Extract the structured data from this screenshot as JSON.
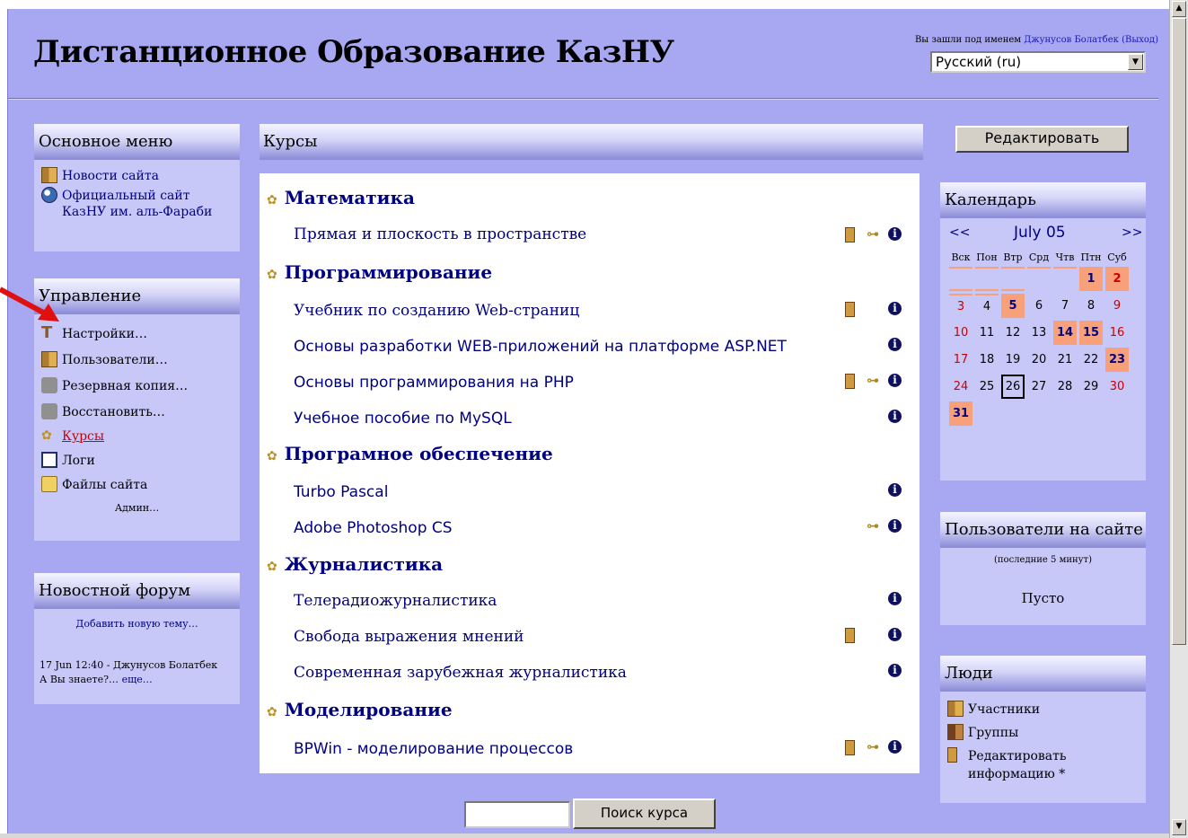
{
  "header": {
    "site_title": "Дистанционное Образование КазНУ",
    "login_prefix": "Вы зашли под именем ",
    "user_name": "Джунусов Болатбек",
    "logout_label": "(Выход)",
    "language": "Русский (ru)"
  },
  "main_menu": {
    "title": "Основное меню",
    "items": [
      {
        "label": "Новости сайта",
        "icon": "people-icon"
      },
      {
        "label": "Официальный сайт",
        "icon": "globe-icon"
      }
    ],
    "item2_line2": "КазНУ им. аль-Фараби"
  },
  "admin": {
    "title": "Управление",
    "items": [
      {
        "label": "Настройки…",
        "icon": "hammer-icon"
      },
      {
        "label": "Пользователи…",
        "icon": "people-icon"
      },
      {
        "label": "Резервная копия…",
        "icon": "backup-icon"
      },
      {
        "label": "Восстановить…",
        "icon": "restore-icon"
      },
      {
        "label": "Курсы",
        "icon": "course-icon"
      },
      {
        "label": "Логи",
        "icon": "log-icon"
      },
      {
        "label": "Файлы сайта",
        "icon": "folder-icon"
      }
    ],
    "admin_link": "Админ…"
  },
  "news_forum": {
    "title": "Новостной форум",
    "add_topic": "Добавить новую тему…",
    "post_date": "17 Jun 12:40 - Джунусов Болатбек",
    "post_title": "А Вы знаете?… ",
    "more_link": "еще…"
  },
  "courses": {
    "title": "Курсы",
    "categories": [
      {
        "name": "Математика",
        "courses": [
          {
            "name": "Прямая и плоскость в пространстве",
            "icons": [
              "doc-icon",
              "key-icon",
              "info-icon"
            ]
          }
        ]
      },
      {
        "name": "Программирование",
        "courses": [
          {
            "name": "Учебник по созданию Web-страниц",
            "icons": [
              "doc-icon",
              "info-icon"
            ]
          },
          {
            "name": "Основы разработки WEB-приложений на платформе ASP.NET",
            "icons": [
              "info-icon"
            ]
          },
          {
            "name": "Основы программирования на PHP",
            "icons": [
              "doc-icon",
              "key-icon",
              "info-icon"
            ]
          },
          {
            "name": "Учебное пособие по MySQL",
            "icons": [
              "info-icon"
            ]
          }
        ]
      },
      {
        "name": "Програмное обеспечение",
        "courses": [
          {
            "name": "Turbo Pascal",
            "icons": [
              "info-icon"
            ]
          },
          {
            "name": "Adobe Photoshop CS",
            "icons": [
              "key-icon",
              "info-icon"
            ]
          }
        ]
      },
      {
        "name": "Журналистика",
        "courses": [
          {
            "name": "Телерадиожурналистика",
            "icons": [
              "info-icon"
            ]
          },
          {
            "name": "Свобода выражения мнений",
            "icons": [
              "doc-icon",
              "info-icon"
            ]
          },
          {
            "name": "Современная зарубежная журналистика",
            "icons": [
              "info-icon"
            ]
          }
        ]
      },
      {
        "name": "Моделирование",
        "courses": [
          {
            "name": "BPWin - моделирование процессов",
            "icons": [
              "doc-icon",
              "key-icon",
              "info-icon"
            ]
          }
        ]
      }
    ]
  },
  "search": {
    "button_label": "Поиск курса",
    "value": ""
  },
  "edit_button": "Редактировать",
  "calendar": {
    "title": "Календарь",
    "prev": "<<",
    "month": "July 05",
    "next": ">>",
    "weekdays": [
      "Вск",
      "Пон",
      "Втр",
      "Срд",
      "Чтв",
      "Птн",
      "Суб"
    ],
    "days": [
      "1",
      "2",
      "3",
      "4",
      "5",
      "6",
      "7",
      "8",
      "9",
      "10",
      "11",
      "12",
      "13",
      "14",
      "15",
      "16",
      "17",
      "18",
      "19",
      "20",
      "21",
      "22",
      "23",
      "24",
      "25",
      "26",
      "27",
      "28",
      "29",
      "30",
      "31"
    ],
    "event_days": [
      "1",
      "2",
      "3",
      "5",
      "14",
      "15",
      "23",
      "31"
    ],
    "today": "26"
  },
  "online_users": {
    "title": "Пользователи на сайте",
    "subtitle": "(последние 5 минут)",
    "empty": "Пусто"
  },
  "people": {
    "title": "Люди",
    "items": [
      "Участники",
      "Группы",
      "Редактировать"
    ],
    "edit_line2": "информацию",
    "asterisk": "*"
  },
  "colors": {
    "page_bg": "#a8a8f2",
    "block_bg": "#c8c8f8",
    "link": "#000080",
    "event": "#f7a07a",
    "weekend": "#cc0000"
  }
}
